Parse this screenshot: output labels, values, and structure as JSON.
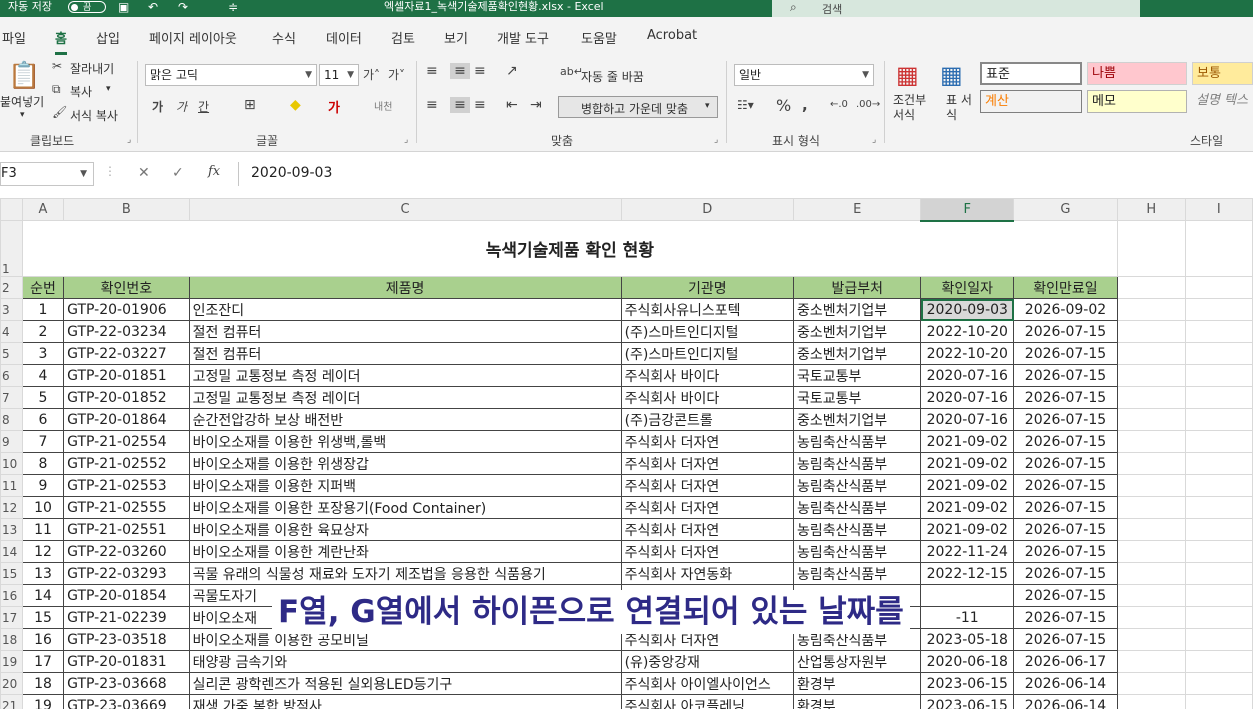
{
  "titlebar": {
    "autosave_label": "자동 저장",
    "toggle_state": "끔",
    "doc_title": "엑셀자료1_녹색기술제품확인현황.xlsx  -  Excel",
    "search_placeholder": "검색"
  },
  "tabs": [
    "파일",
    "홈",
    "삽입",
    "페이지 레이아웃",
    "수식",
    "데이터",
    "검토",
    "보기",
    "개발 도구",
    "도움말",
    "Acrobat"
  ],
  "ribbon": {
    "clipboard": {
      "paste": "붙여넣기",
      "cut": "잘라내기",
      "copy": "복사",
      "format_painter": "서식 복사",
      "label": "클립보드"
    },
    "font": {
      "name": "맑은 고딕",
      "size": "11",
      "label": "글꼴"
    },
    "align": {
      "wrap": "자동 줄 바꿈",
      "merge": "병합하고 가운데 맞춤",
      "label": "맞춤"
    },
    "number": {
      "format": "일반",
      "label": "표시 형식"
    },
    "styles": {
      "conditional": "조건부 서식",
      "table": "표 서식",
      "normal": "표준",
      "bad": "나쁨",
      "neutral": "보통",
      "calc": "계산",
      "memo": "메모",
      "explain": "설명 텍스",
      "label": "스타일"
    }
  },
  "formula_bar": {
    "name_box": "F3",
    "value": "2020-09-03"
  },
  "columns": [
    "A",
    "B",
    "C",
    "D",
    "E",
    "F",
    "G",
    "H",
    "I"
  ],
  "sheet": {
    "title": "녹색기술제품 확인 현황",
    "headers": [
      "순번",
      "확인번호",
      "제품명",
      "기관명",
      "발급부처",
      "확인일자",
      "확인만료일"
    ],
    "rows": [
      [
        "1",
        "GTP-20-01906",
        "인조잔디",
        "주식회사유니스포텍",
        "중소벤처기업부",
        "2020-09-03",
        "2026-09-02"
      ],
      [
        "2",
        "GTP-22-03234",
        "절전 컴퓨터",
        "(주)스마트인디지털",
        "중소벤처기업부",
        "2022-10-20",
        "2026-07-15"
      ],
      [
        "3",
        "GTP-22-03227",
        "절전 컴퓨터",
        "(주)스마트인디지털",
        "중소벤처기업부",
        "2022-10-20",
        "2026-07-15"
      ],
      [
        "4",
        "GTP-20-01851",
        "고정밀 교통정보 측정 레이더",
        "주식회사 바이다",
        "국토교통부",
        "2020-07-16",
        "2026-07-15"
      ],
      [
        "5",
        "GTP-20-01852",
        "고정밀 교통정보 측정 레이더",
        "주식회사 바이다",
        "국토교통부",
        "2020-07-16",
        "2026-07-15"
      ],
      [
        "6",
        "GTP-20-01864",
        "순간전압강하 보상 배전반",
        "(주)금강콘트롤",
        "중소벤처기업부",
        "2020-07-16",
        "2026-07-15"
      ],
      [
        "7",
        "GTP-21-02554",
        "바이오소재를 이용한 위생백,롤백",
        "주식회사 더자연",
        "농림축산식품부",
        "2021-09-02",
        "2026-07-15"
      ],
      [
        "8",
        "GTP-21-02552",
        "바이오소재를 이용한 위생장갑",
        "주식회사 더자연",
        "농림축산식품부",
        "2021-09-02",
        "2026-07-15"
      ],
      [
        "9",
        "GTP-21-02553",
        "바이오소재를 이용한 지퍼백",
        "주식회사 더자연",
        "농림축산식품부",
        "2021-09-02",
        "2026-07-15"
      ],
      [
        "10",
        "GTP-21-02555",
        "바이오소재를 이용한 포장용기(Food Container)",
        "주식회사 더자연",
        "농림축산식품부",
        "2021-09-02",
        "2026-07-15"
      ],
      [
        "11",
        "GTP-21-02551",
        "바이오소재를 이용한 육묘상자",
        "주식회사 더자연",
        "농림축산식품부",
        "2021-09-02",
        "2026-07-15"
      ],
      [
        "12",
        "GTP-22-03260",
        "바이오소재를 이용한 계란난좌",
        "주식회사 더자연",
        "농림축산식품부",
        "2022-11-24",
        "2026-07-15"
      ],
      [
        "13",
        "GTP-22-03293",
        "곡물 유래의 식물성 재료와 도자기 제조법을 응용한 식품용기",
        "주식회사 자연동화",
        "농림축산식품부",
        "2022-12-15",
        "2026-07-15"
      ],
      [
        "14",
        "GTP-20-01854",
        "곡물도자기",
        "",
        "",
        "",
        "2026-07-15"
      ],
      [
        "15",
        "GTP-21-02239",
        "바이오소재",
        "",
        "",
        "-11",
        "2026-07-15"
      ],
      [
        "16",
        "GTP-23-03518",
        "바이오소재를 이용한 공모비닐",
        "주식회사 더자연",
        "농림축산식품부",
        "2023-05-18",
        "2026-07-15"
      ],
      [
        "17",
        "GTP-20-01831",
        "태양광 금속기와",
        "(유)중앙강재",
        "산업통상자원부",
        "2020-06-18",
        "2026-06-17"
      ],
      [
        "18",
        "GTP-23-03668",
        "실리콘 광학렌즈가 적용된 실외용LED등기구",
        "주식회사 아이엘사이언스",
        "환경부",
        "2023-06-15",
        "2026-06-14"
      ],
      [
        "19",
        "GTP-23-03669",
        "재생 가죽 복합 방적사",
        "주식회사 아코플레닝",
        "환경부",
        "2023-06-15",
        "2026-06-14"
      ]
    ]
  },
  "subtitle": "F열, G열에서 하이픈으로 연결되어 있는 날짜를",
  "colors": {
    "accent": "#1e7145",
    "header_fill": "#a9d08e",
    "subtitle": "#2e2a86"
  }
}
